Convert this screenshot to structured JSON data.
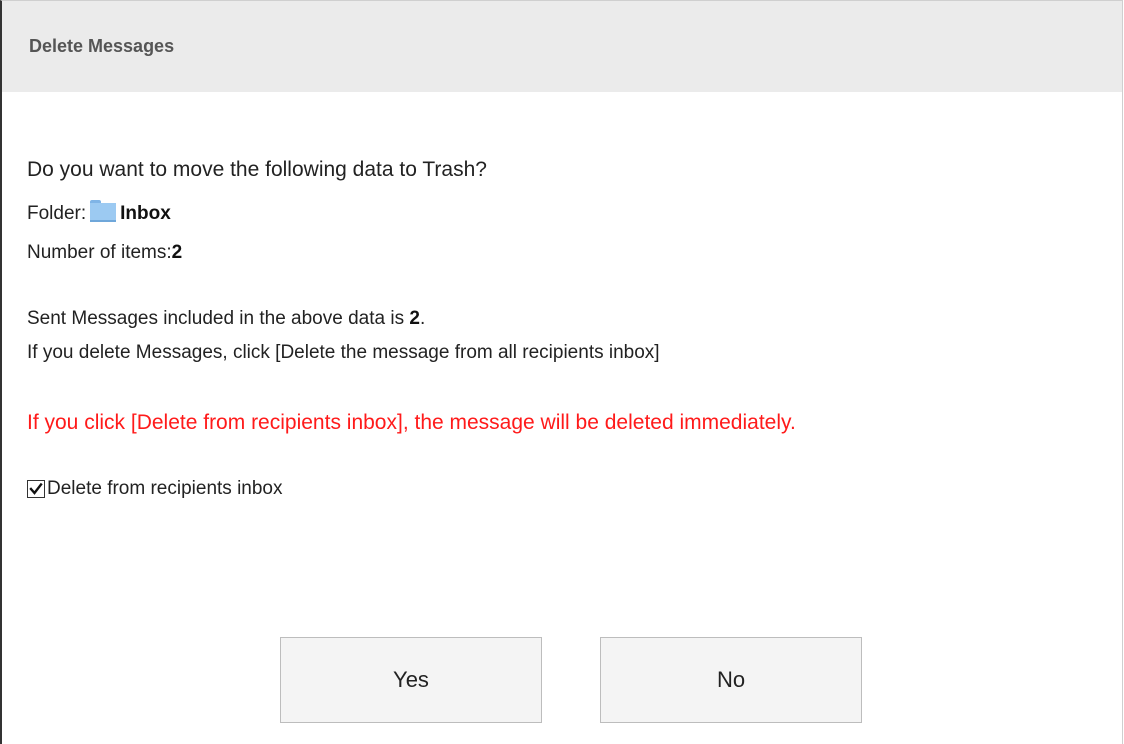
{
  "dialog": {
    "title": "Delete Messages"
  },
  "content": {
    "question": "Do you want to move the following data to Trash?",
    "folder_label": "Folder:",
    "folder_icon": "folder-icon",
    "folder_name": "Inbox",
    "items_label": "Number of items:",
    "items_count": "2",
    "sent_prefix": "Sent Messages included in the above data is ",
    "sent_count": "2",
    "sent_suffix": ".",
    "instruction": "If you delete Messages, click [Delete the message from all recipients inbox]",
    "warning": "If you click [Delete from recipients inbox], the message will be deleted immediately.",
    "warning_color": "#ff1a1a",
    "checkbox_label": "Delete from recipients inbox",
    "checkbox_checked": true
  },
  "buttons": {
    "yes_label": "Yes",
    "no_label": "No"
  }
}
